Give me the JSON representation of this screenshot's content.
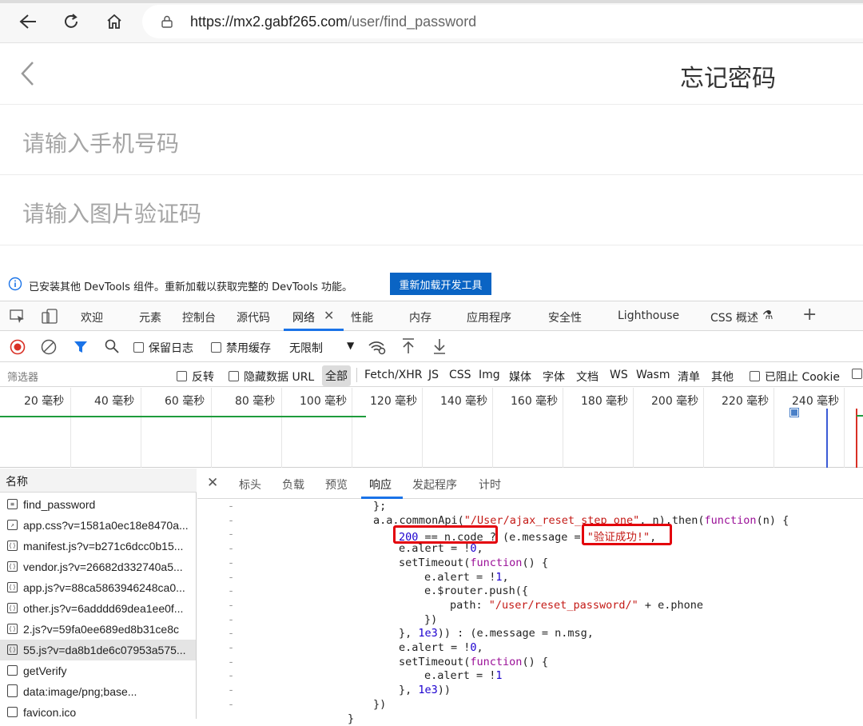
{
  "browser": {
    "url": "https://mx2.gabf265.com/user/find_password",
    "url_host": "https://mx2.gabf265.com",
    "url_path": "/user/find_password"
  },
  "app": {
    "title": "忘记密码",
    "phone_placeholder": "请输入手机号码",
    "captcha_placeholder": "请输入图片验证码"
  },
  "infobar": {
    "message": "已安装其他 DevTools 组件。重新加载以获取完整的 DevTools 功能。",
    "button": "重新加载开发工具"
  },
  "devtools": {
    "tabs": [
      "欢迎",
      "元素",
      "控制台",
      "源代码",
      "网络",
      "性能",
      "内存",
      "应用程序",
      "安全性",
      "Lighthouse",
      "CSS 概述"
    ],
    "active_tab": "网络",
    "toolbar": {
      "preserve_log": "保留日志",
      "disable_cache": "禁用缓存",
      "throttling": "无限制"
    },
    "filter": {
      "placeholder": "筛选器",
      "invert": "反转",
      "hide_data_urls": "隐藏数据 URL",
      "types": [
        "全部",
        "Fetch/XHR",
        "JS",
        "CSS",
        "Img",
        "媒体",
        "字体",
        "文档",
        "WS",
        "Wasm",
        "清单",
        "其他"
      ],
      "blocked_cookies": "已阻止 Cookie"
    },
    "timeline_ticks": [
      "20 毫秒",
      "40 毫秒",
      "60 毫秒",
      "80 毫秒",
      "100 毫秒",
      "120 毫秒",
      "140 毫秒",
      "160 毫秒",
      "180 毫秒",
      "200 毫秒",
      "220 毫秒",
      "240 毫秒"
    ],
    "requests_header": "名称",
    "requests": [
      {
        "name": "find_password",
        "icon": "document-icon"
      },
      {
        "name": "app.css?v=1581a0ec18e8470a...",
        "icon": "stylesheet-icon"
      },
      {
        "name": "manifest.js?v=b271c6dcc0b15...",
        "icon": "script-icon"
      },
      {
        "name": "vendor.js?v=26682d332740a5...",
        "icon": "script-icon"
      },
      {
        "name": "app.js?v=88ca5863946248ca0...",
        "icon": "script-icon"
      },
      {
        "name": "other.js?v=6adddd69dea1ee0f...",
        "icon": "script-icon"
      },
      {
        "name": "2.js?v=59fa0ee689ed8b31ce8c",
        "icon": "script-icon"
      },
      {
        "name": "55.js?v=da8b1de6c07953a575...",
        "icon": "script-icon",
        "selected": true
      },
      {
        "name": "getVerify",
        "icon": "checkbox-icon"
      },
      {
        "name": "data:image/png;base...",
        "icon": "image-file-icon"
      },
      {
        "name": "favicon.ico",
        "icon": "checkbox-icon"
      }
    ],
    "detail_tabs": [
      "标头",
      "负载",
      "预览",
      "响应",
      "发起程序",
      "计时"
    ],
    "active_detail_tab": "响应",
    "code_lines": [
      "};",
      "a.a.commonApi(\"/User/ajax_reset_step_one\", n).then(function(n) {",
      "200 == n.code ? (e.message = \"验证成功!\",",
      "e.alert = !0,",
      "setTimeout(function() {",
      "e.alert = !1,",
      "e.$router.push({",
      "path: \"/user/reset_password/\" + e.phone",
      "})",
      "}, 1e3)) : (e.message = n.msg,",
      "e.alert = !0,",
      "setTimeout(function() {",
      "e.alert = !1",
      "}, 1e3))",
      "})",
      "}"
    ]
  }
}
